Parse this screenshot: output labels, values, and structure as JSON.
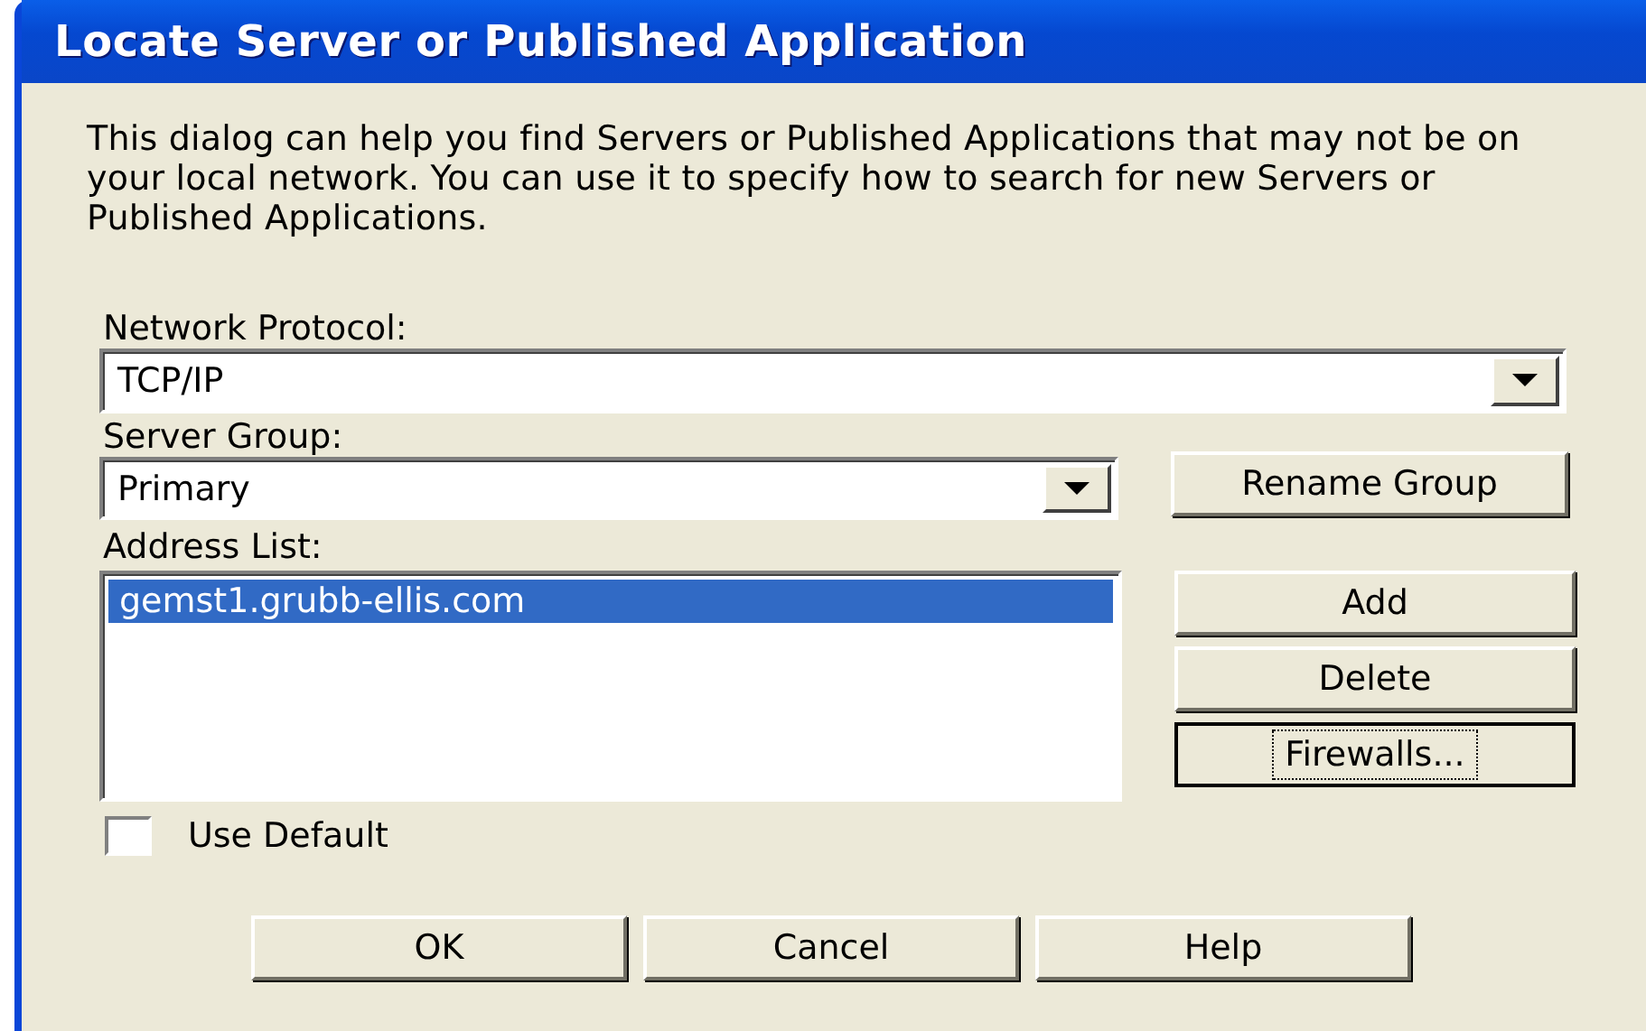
{
  "window": {
    "title": "Locate Server or Published Application"
  },
  "intro": "This dialog can help you find Servers or Published Applications that may not be on your local network.  You can use it to specify how to search for new Servers or Published Applications.",
  "network_protocol": {
    "label": "Network Protocol:",
    "value": "TCP/IP"
  },
  "server_group": {
    "label": "Server Group:",
    "value": "Primary"
  },
  "rename_button": {
    "label": "Rename Group",
    "focused": false
  },
  "address_list": {
    "label": "Address List:",
    "items": [
      {
        "text": "gemst1.grubb-ellis.com",
        "selected": true
      }
    ]
  },
  "side_buttons": [
    {
      "label": "Add",
      "focused": false
    },
    {
      "label": "Delete",
      "focused": false
    },
    {
      "label": "Firewalls...",
      "focused": true
    }
  ],
  "use_default": {
    "label": "Use Default",
    "checked": false
  },
  "buttons": [
    {
      "label": "OK",
      "focused": false
    },
    {
      "label": "Cancel",
      "focused": false
    },
    {
      "label": "Help",
      "focused": false
    }
  ]
}
